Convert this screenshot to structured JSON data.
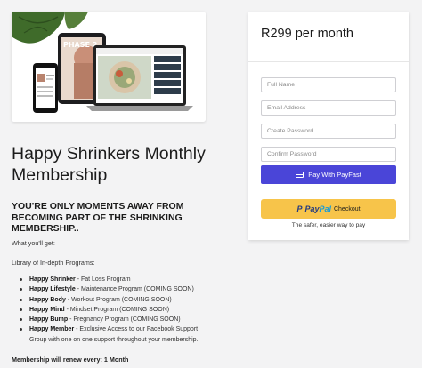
{
  "left": {
    "title_line1": "Happy Shrinkers Monthly",
    "title_line2": "Membership",
    "subhead_line1": "YOU'RE ONLY MOMENTS AWAY FROM",
    "subhead_line2": "BECOMING PART OF THE SHRINKING",
    "subhead_line3": "MEMBERSHIP..",
    "what_label": "What you'll get:",
    "library_label": "Library of In-depth Programs:",
    "programs": [
      {
        "name": "Happy Shrinker",
        "desc": " - Fat Loss Program"
      },
      {
        "name": "Happy Lifestyle",
        "desc": " - Maintenance Program (COMING SOON)"
      },
      {
        "name": "Happy Body",
        "desc": " - Workout Program (COMING SOON)"
      },
      {
        "name": "Happy Mind",
        "desc": " - Mindset Program (COMING SOON)"
      },
      {
        "name": "Happy Bump",
        "desc": " - Pregnancy Program (COMING SOON)"
      },
      {
        "name": "Happy Member",
        "desc": " - Exclusive Access to our Facebook Support"
      }
    ],
    "program_cont": "Group with one on one support throughout your membership.",
    "renew_label": "Membership will renew every: ",
    "renew_value": "1 Month"
  },
  "hero": {
    "screen_title": "PHASE 2"
  },
  "checkout": {
    "price": "R299 per month",
    "full_name_placeholder": "Full Name",
    "email_placeholder": "Email Address",
    "create_password_placeholder": "Create Password",
    "confirm_password_placeholder": "Confirm Password",
    "payfast_label": "Pay With PayFast",
    "paypal_pay": "Pay",
    "paypal_pal": "Pal",
    "paypal_checkout": "Checkout",
    "paypal_tagline": "The safer, easier way to pay"
  },
  "colors": {
    "payfast_button": "#4a45d8",
    "paypal_button": "#f7c44a",
    "background": "#f3f3f4"
  }
}
